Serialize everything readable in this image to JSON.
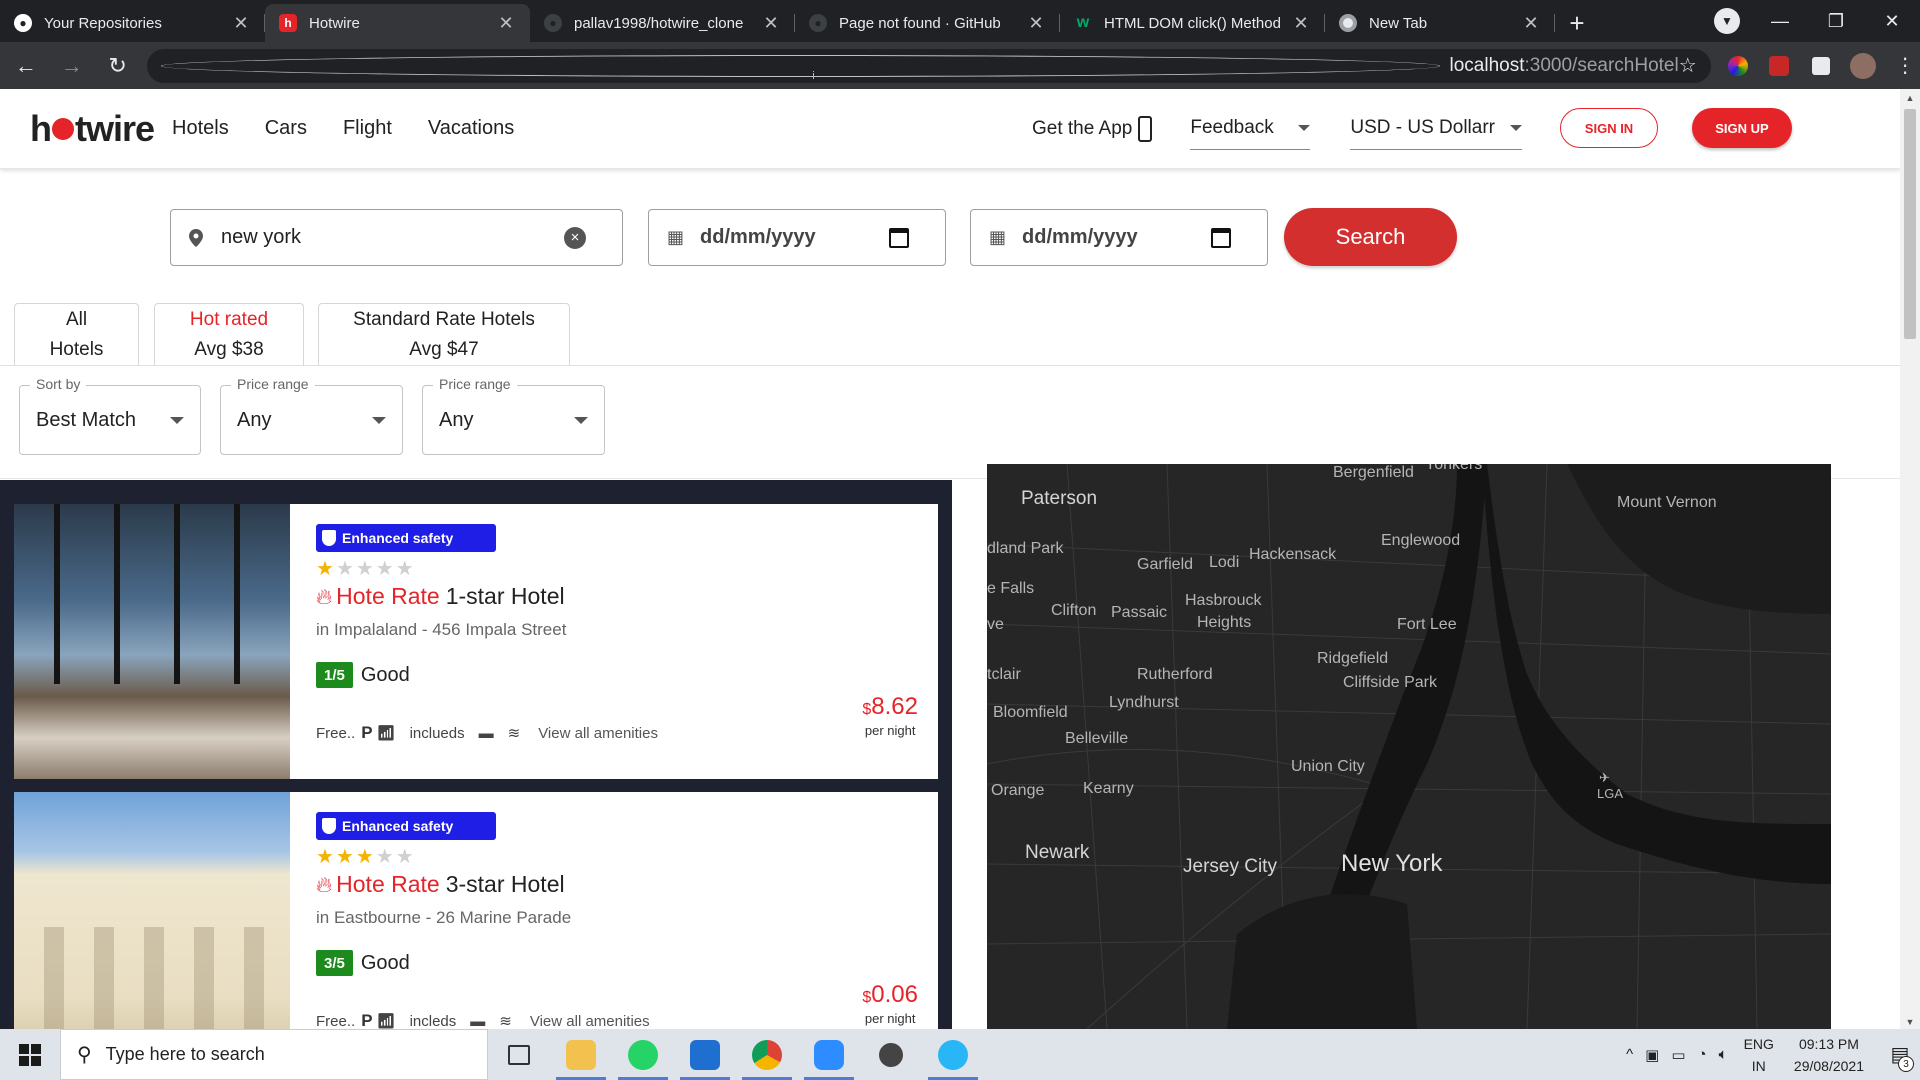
{
  "browser": {
    "tabs": [
      {
        "title": "Your Repositories",
        "favicon": "github-icon",
        "color": "#ffffff",
        "active": false
      },
      {
        "title": "Hotwire",
        "favicon": "hotwire-icon",
        "color": "#e52429",
        "active": true
      },
      {
        "title": "pallav1998/hotwire_clone",
        "favicon": "github-icon",
        "color": "#ffffff",
        "active": false
      },
      {
        "title": "Page not found · GitHub",
        "favicon": "github-icon",
        "color": "#ffffff",
        "active": false
      },
      {
        "title": "HTML DOM click() Method",
        "favicon": "w3schools-icon",
        "color": "#04aa6d",
        "active": false
      },
      {
        "title": "New Tab",
        "favicon": "chrome-icon",
        "color": "#9aa0a6",
        "active": false
      }
    ],
    "url_host": "localhost",
    "url_path": ":3000/searchHotel"
  },
  "site": {
    "logo": {
      "pre": "h",
      "post": "twire"
    },
    "nav": [
      "Hotels",
      "Cars",
      "Flight",
      "Vacations"
    ],
    "get_app": "Get the App",
    "feedback": "Feedback",
    "currency": "USD - US Dollarr",
    "sign_in": "SIGN IN",
    "sign_up": "SIGN UP",
    "accent_color": "#e52429"
  },
  "search": {
    "location_value": "new york",
    "checkin_value": "dd/mm/yyyy",
    "checkout_value": "dd/mm/yyyy",
    "button": "Search"
  },
  "category_tabs": [
    {
      "line1": "All",
      "line2": "Hotels"
    },
    {
      "line1": "Hot rated",
      "line2": "Avg $38"
    },
    {
      "line1": "Standard Rate Hotels",
      "line2": "Avg $47"
    }
  ],
  "filters": [
    {
      "label": "Sort by",
      "value": "Best Match"
    },
    {
      "label": "Price range",
      "value": "Any"
    },
    {
      "label": "Price range",
      "value": "Any"
    }
  ],
  "hotels": [
    {
      "badge": "Enhanced safety",
      "stars": 1,
      "title_red": "Hote Rate",
      "title_rest": "1-star Hotel",
      "address": "in Impalaland - 456 Impala Street",
      "score": "1/5",
      "score_label": "Good",
      "amenity_free": "Free..",
      "amenity_includes": "inclueds",
      "view_amenities": "View all amenities",
      "currency": "$",
      "price": "8.62",
      "per_night": "per night"
    },
    {
      "badge": "Enhanced safety",
      "stars": 3,
      "title_red": "Hote Rate",
      "title_rest": "3-star Hotel",
      "address": "in Eastbourne - 26 Marine Parade",
      "score": "3/5",
      "score_label": "Good",
      "amenity_free": "Free..",
      "amenity_includes": "incleds",
      "view_amenities": "View all amenities",
      "currency": "$",
      "price": "0.06",
      "per_night": "per night"
    }
  ],
  "map_labels": [
    "Yonkers",
    "Bergenfield",
    "Paterson",
    "Mount Vernon",
    "dland Park",
    "Englewood",
    "Garfield",
    "Lodi",
    "Hackensack",
    "e Falls",
    "Hasbrouck",
    "Heights",
    "Clifton",
    "Passaic",
    "Fort Lee",
    "ve",
    "Ridgefield",
    "tclair",
    "Rutherford",
    "Cliffside Park",
    "Lyndhurst",
    "Bloomfield",
    "Belleville",
    "Union City",
    "LGA",
    "Orange",
    "Kearny",
    "Newark",
    "Jersey City",
    "New York"
  ],
  "taskbar": {
    "search_placeholder": "Type here to search",
    "lang1": "ENG",
    "lang2": "IN",
    "time": "09:13 PM",
    "date": "29/08/2021",
    "notifications": "3"
  }
}
